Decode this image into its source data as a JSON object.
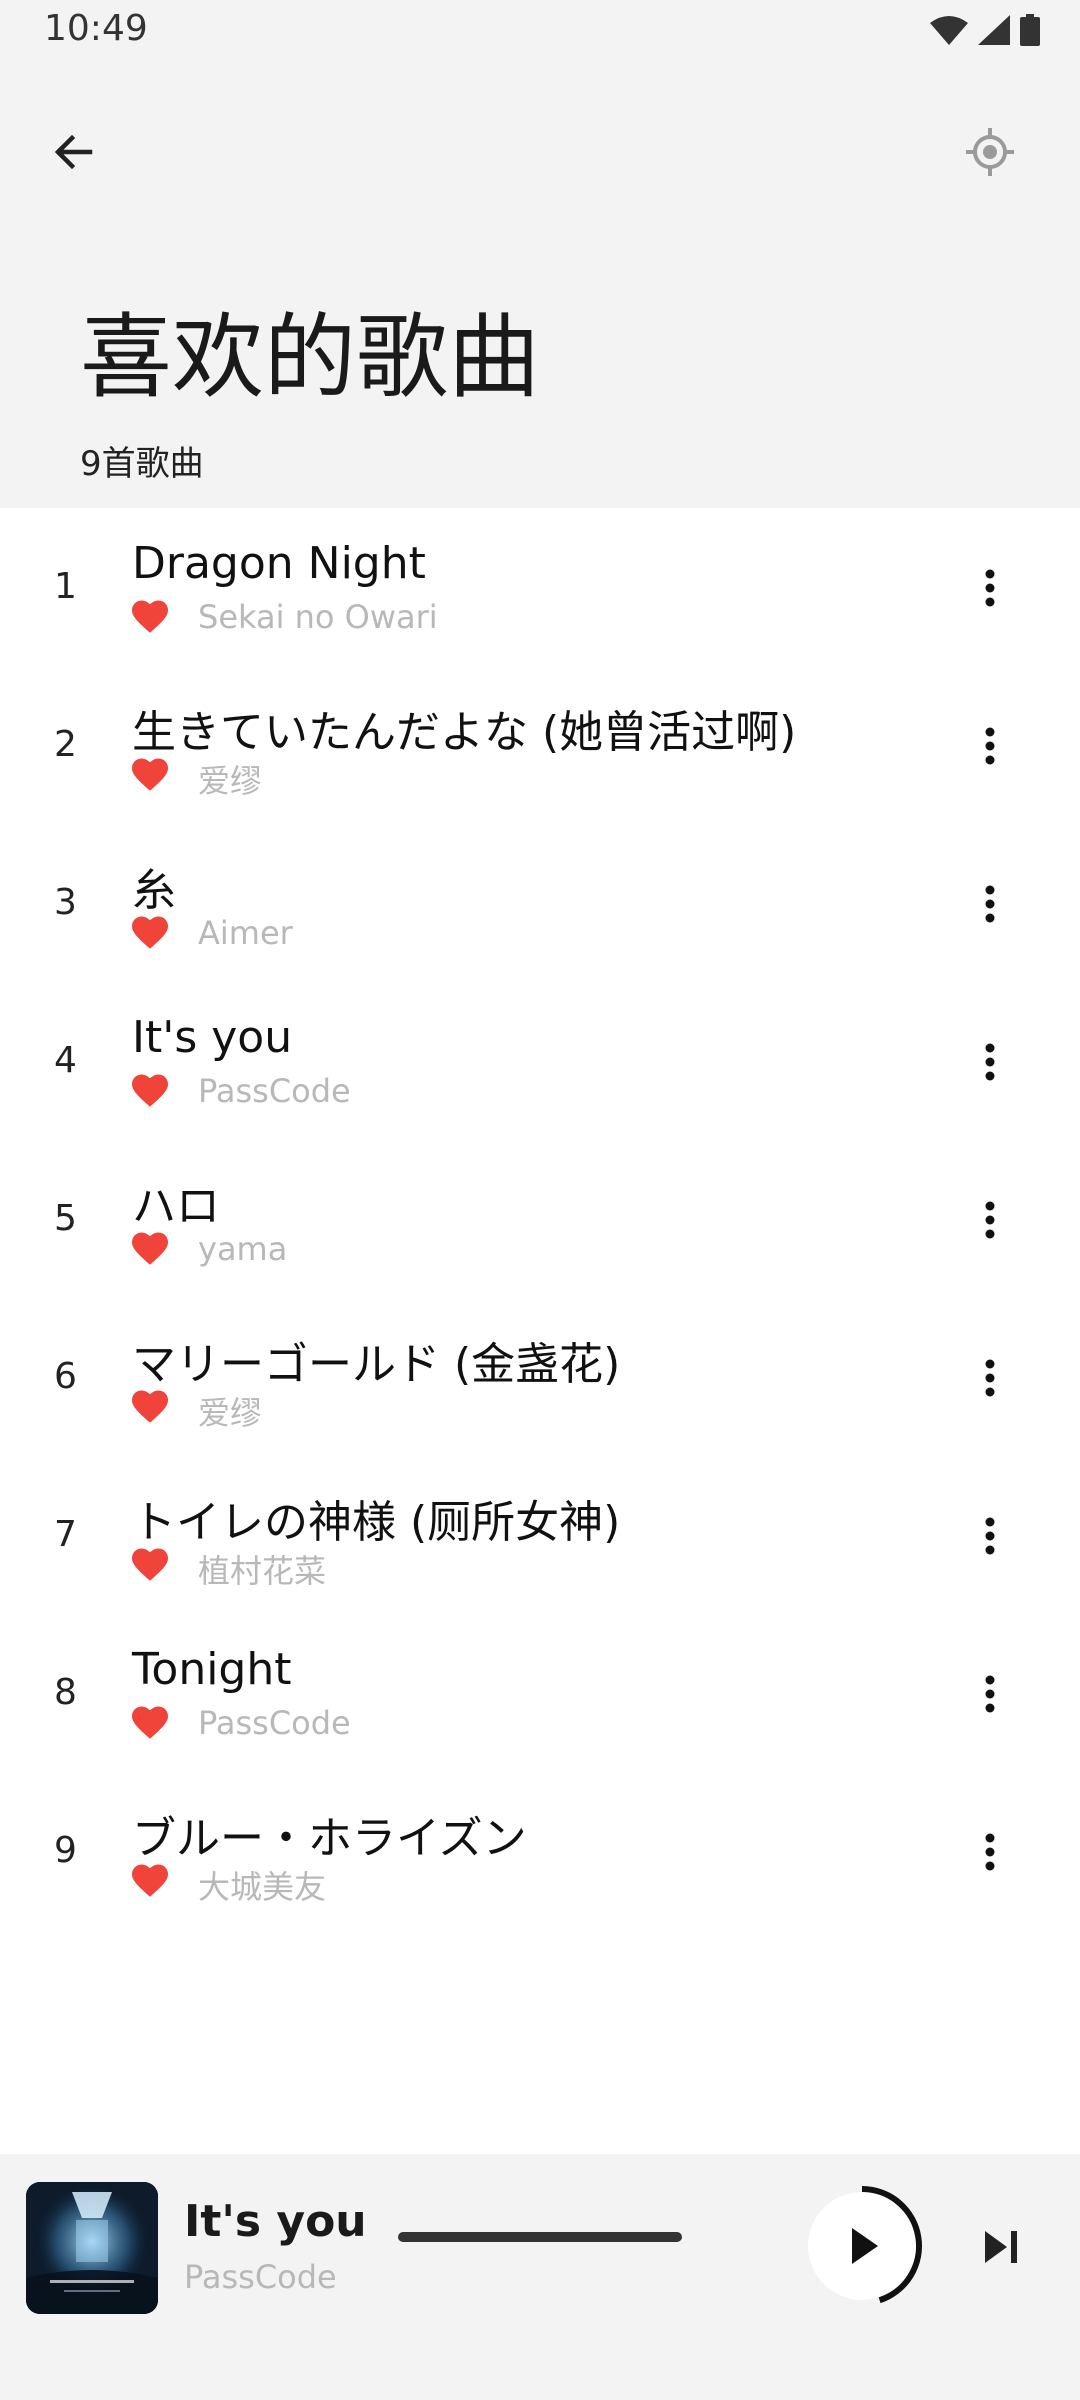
{
  "status_bar": {
    "time": "10:49"
  },
  "header": {
    "title": "喜欢的歌曲",
    "song_count": "9首歌曲",
    "back_icon": "arrow-back-icon",
    "locate_icon": "my-location-icon"
  },
  "songs": [
    {
      "index": "1",
      "title": "Dragon Night",
      "artist": "Sekai no Owari"
    },
    {
      "index": "2",
      "title": "生きていたんだよな (她曾活过啊)",
      "artist": "爱缪"
    },
    {
      "index": "3",
      "title": "糸",
      "artist": "Aimer"
    },
    {
      "index": "4",
      "title": "It's you",
      "artist": "PassCode"
    },
    {
      "index": "5",
      "title": "ハロ",
      "artist": "yama"
    },
    {
      "index": "6",
      "title": "マリーゴールド (金盏花)",
      "artist": "爱缪"
    },
    {
      "index": "7",
      "title": "トイレの神様 (厕所女神)",
      "artist": "植村花菜"
    },
    {
      "index": "8",
      "title": "Tonight",
      "artist": "PassCode"
    },
    {
      "index": "9",
      "title": "ブルー・ホライズン",
      "artist": "大城美友"
    }
  ],
  "now_playing": {
    "title": "It's you",
    "artist": "PassCode",
    "progress": 0.45
  },
  "colors": {
    "header_bg": "#f3f3f3",
    "heart": "#f0433a",
    "artist_text": "#b8b8b8",
    "player_bg": "#f3f3f3"
  }
}
